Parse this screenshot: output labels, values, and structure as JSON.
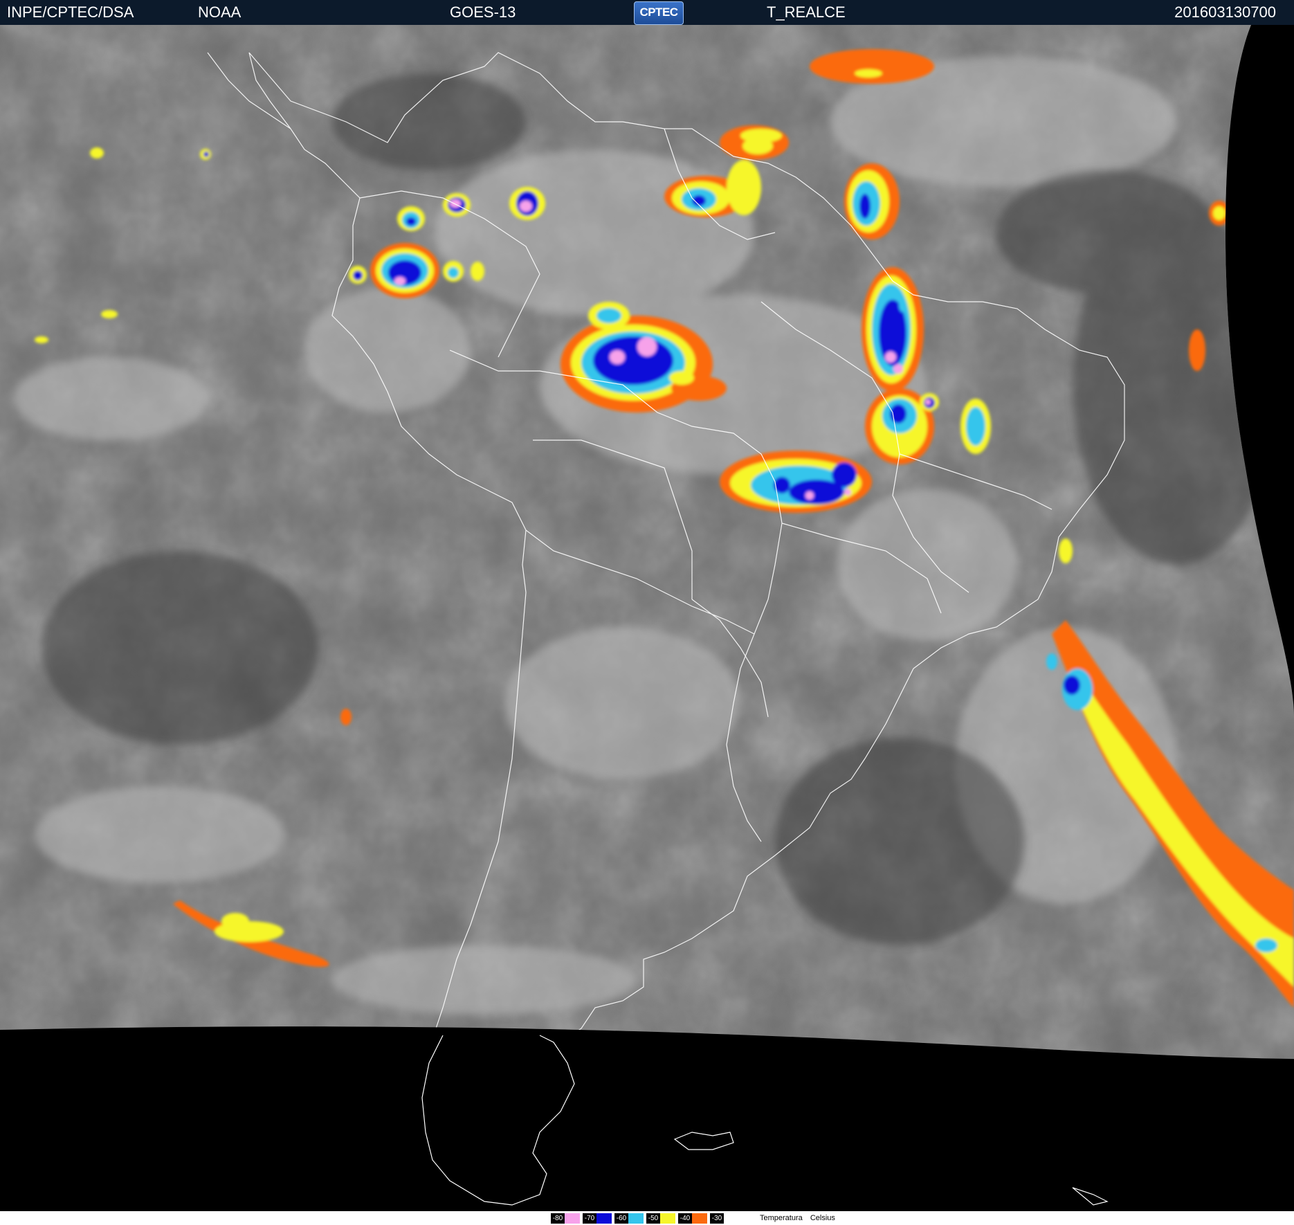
{
  "header": {
    "institution": "INPE/CPTEC/DSA",
    "agency": "NOAA",
    "satellite": "GOES-13",
    "logo": "CPTEC",
    "product": "T_REALCE",
    "timestamp": "201603130700"
  },
  "legend": {
    "levels": [
      {
        "label": "-80",
        "color": "#f7a2ea"
      },
      {
        "label": "-70",
        "color": "#0b0bd8"
      },
      {
        "label": "-60",
        "color": "#35c5ec"
      },
      {
        "label": "-50",
        "color": "#f6f62b"
      },
      {
        "label": "-40",
        "color": "#fb6a0f"
      },
      {
        "label": "-30",
        "color": "#f7f7f7"
      }
    ],
    "caption_word": "Temperatura",
    "caption_unit": "Celsius"
  },
  "colors": {
    "space": "#000000",
    "cloud_base": "#6d6d6d",
    "coastline": "#ffffff",
    "cold_top_pink": "#f7a2ea",
    "cold_top_blue": "#0b0bd8",
    "cold_top_cyan": "#35c5ec",
    "cold_top_yellow": "#f6f62b",
    "cold_top_orange": "#fb6a0f"
  }
}
